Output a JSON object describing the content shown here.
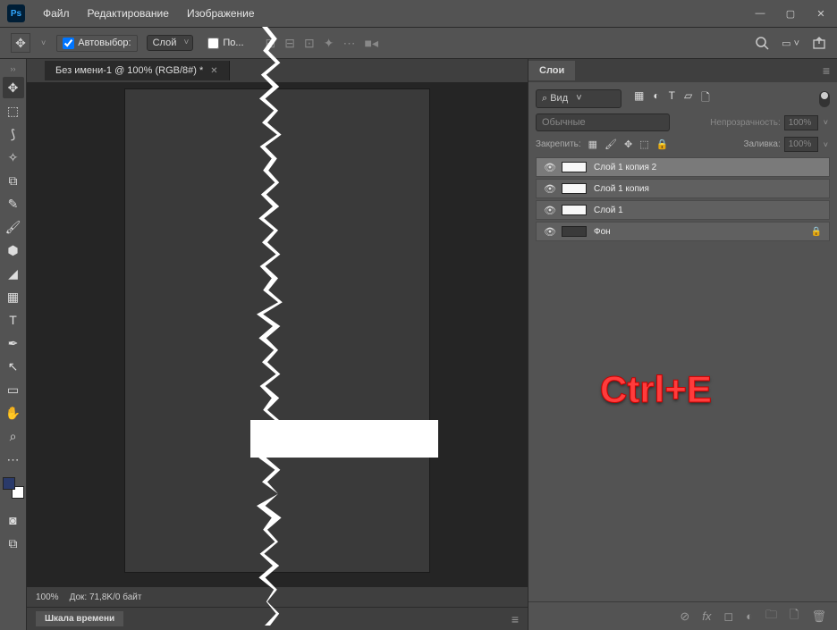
{
  "app": {
    "logo": "Ps"
  },
  "menu": {
    "file": "Файл",
    "edit": "Редактирование",
    "image": "Изображение"
  },
  "options": {
    "autoselect": "Автовыбор:",
    "layer": "Слой",
    "show": "По..."
  },
  "document": {
    "tab": "Без имени-1 @ 100% (RGB/8#) *",
    "zoom": "100%",
    "docinfo": "Док: 71,8K/0 байт"
  },
  "timeline": {
    "label": "Шкала времени"
  },
  "layers_panel": {
    "title": "Слои",
    "filter": "Вид",
    "blend": "Обычные",
    "opacity_label": "Непрозрачность:",
    "opacity": "100%",
    "lock_label": "Закрепить:",
    "fill_label": "Заливка:",
    "fill": "100%",
    "layers": [
      {
        "name": "Слой 1 копия 2",
        "locked": false
      },
      {
        "name": "Слой 1 копия",
        "locked": false
      },
      {
        "name": "Слой 1",
        "locked": false
      },
      {
        "name": "Фон",
        "locked": true
      }
    ]
  },
  "annotation": "Ctrl+E"
}
